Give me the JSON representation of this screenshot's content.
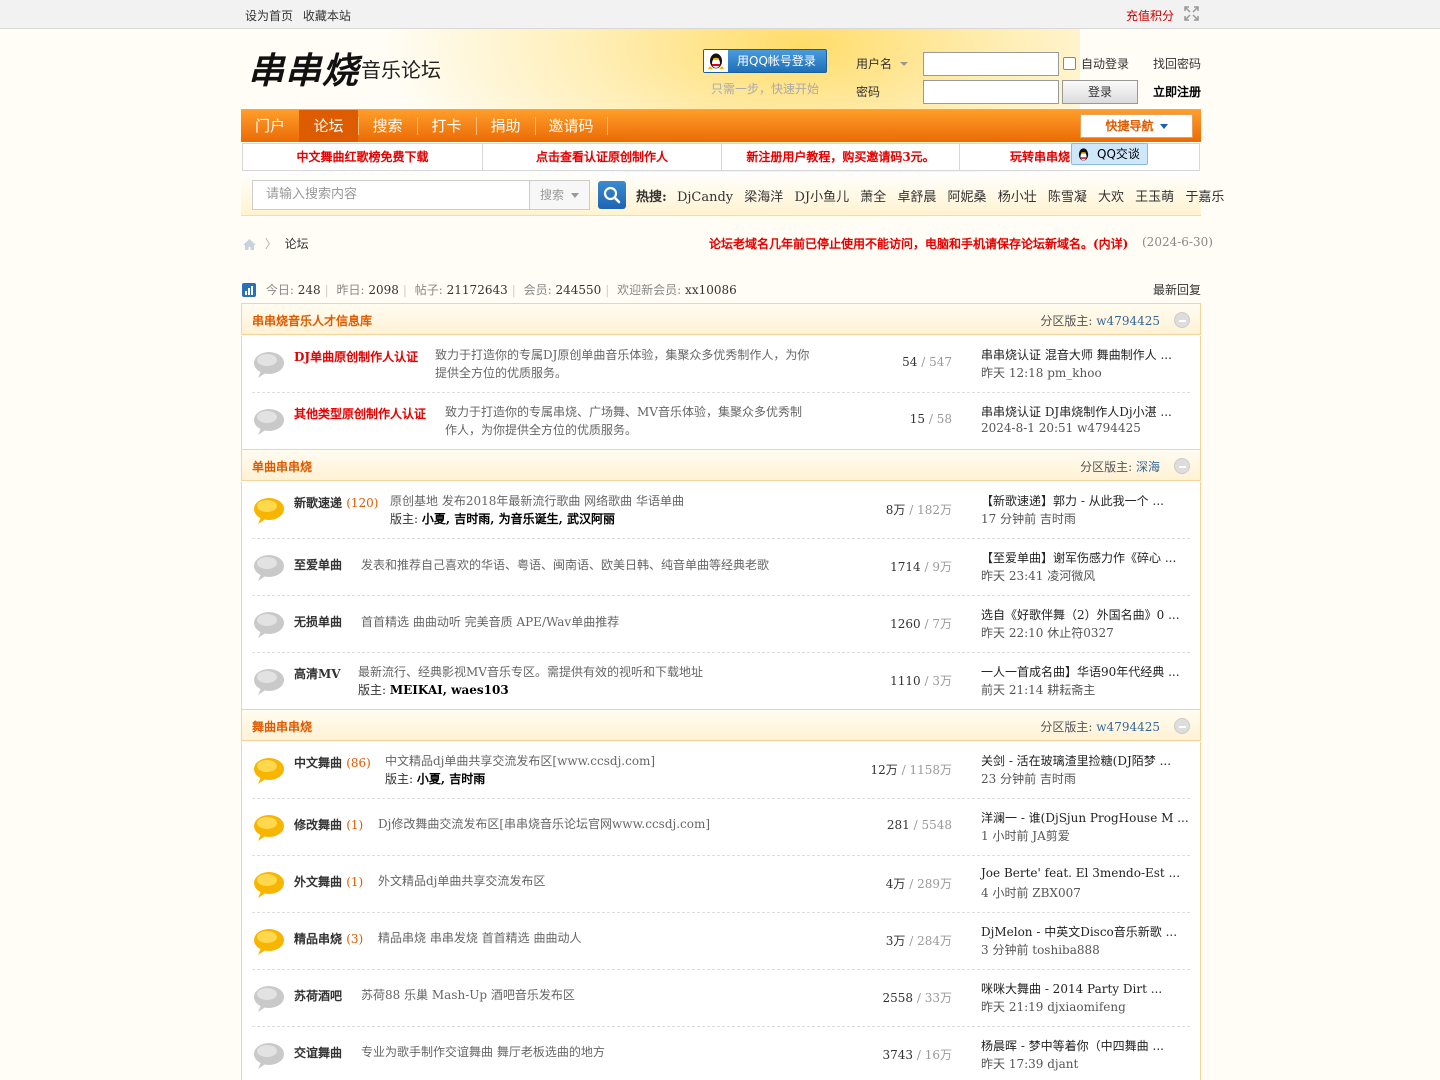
{
  "topbar": {
    "set_home": "设为首页",
    "favorite": "收藏本站",
    "recharge": "充值积分"
  },
  "logo": {
    "main": "串串烧",
    "sub": "音乐论坛"
  },
  "qq_login": {
    "button": "用QQ帐号登录",
    "hint": "只需一步，快速开始"
  },
  "login": {
    "username_label": "用户名",
    "password_label": "密码",
    "auto_login": "自动登录",
    "forgot": "找回密码",
    "login_button": "登录",
    "register": "立即注册"
  },
  "nav": {
    "items": [
      "门户",
      "论坛",
      "搜索",
      "打卡",
      "捐助",
      "邀请码"
    ],
    "active": "论坛",
    "quick_nav": "快捷导航"
  },
  "promo": [
    "中文舞曲红歌榜免费下载",
    "点击查看认证原创制作人",
    "新注册用户教程，购买邀请码3元。",
    "玩转串串烧"
  ],
  "qq_chat": "QQ交谈",
  "search": {
    "placeholder": "请输入搜索内容",
    "type": "搜索",
    "hot_label": "热搜:",
    "hot": [
      "DjCandy",
      "梁海洋",
      "DJ小鱼儿",
      "萧全",
      "卓舒晨",
      "阿妮桑",
      "杨小壮",
      "陈雪凝",
      "大欢",
      "王玉萌",
      "于嘉乐"
    ]
  },
  "breadcrumb": {
    "current": "论坛"
  },
  "notice": {
    "text": "论坛老域名几年前已停止使用不能访问，电脑和手机请保存论坛新域名。(内详)",
    "date": "(2024-6-30)"
  },
  "stats": {
    "today_label": "今日:",
    "today": "248",
    "yesterday_label": "昨日:",
    "yesterday": "2098",
    "posts_label": "帖子:",
    "posts": "21172643",
    "members_label": "会员:",
    "members": "244550",
    "newest_label": "欢迎新会员:",
    "newest": "xx10086",
    "latest_reply": "最新回复"
  },
  "sections": [
    {
      "title": "串串烧音乐人才信息库",
      "mod_label": "分区版主:",
      "mod": "w4794425",
      "forums": [
        {
          "name": "DJ单曲原创制作人认证",
          "count": "",
          "desc1": "致力于打造你的专属DJ原创单曲音乐体验，集聚众多优秀制作人，为你",
          "desc2": "提供全方位的优质服务。",
          "mods_label": "",
          "mods": "",
          "threads": "54",
          "posts": "547",
          "last_title": "串串烧认证 混音大师 舞曲制作人 ...",
          "last_meta": "昨天 12:18 pm_khoo"
        },
        {
          "name": "其他类型原创制作人认证",
          "count": "",
          "desc1": "致力于打造你的专属串烧、广场舞、MV音乐体验，集聚众多优秀制",
          "desc2": "作人，为你提供全方位的优质服务。",
          "mods_label": "",
          "mods": "",
          "threads": "15",
          "posts": "58",
          "last_title": "串串烧认证 DJ串烧制作人Dj小湛 ...",
          "last_meta": "2024-8-1 20:51 w4794425"
        }
      ]
    },
    {
      "title": "单曲串串烧",
      "mod_label": "分区版主:",
      "mod": "深海",
      "forums": [
        {
          "name": "新歌速递",
          "count": "(120)",
          "desc1": "原创基地 发布2018年最新流行歌曲 网络歌曲 华语单曲",
          "desc2": "",
          "mods_label": "版主:",
          "mods": "小夏, 吉时雨, 为音乐诞生, 武汉阿丽",
          "threads": "8万",
          "posts": "182万",
          "last_title": "【新歌速递】郭力 - 从此我一个 ...",
          "last_meta": "17 分钟前 吉时雨"
        },
        {
          "name": "至爱单曲",
          "count": "",
          "desc1": "发表和推荐自己喜欢的华语、粤语、闽南语、欧美日韩、纯音单曲等经典老歌",
          "desc2": "",
          "mods_label": "",
          "mods": "",
          "threads": "1714",
          "posts": "9万",
          "last_title": "【至爱单曲】谢军伤感力作《碎心 ...",
          "last_meta": "昨天 23:41 凌河微风"
        },
        {
          "name": "无损单曲",
          "count": "",
          "desc1": "首首精选 曲曲动听 完美音质 APE/Wav单曲推荐",
          "desc2": "",
          "mods_label": "",
          "mods": "",
          "threads": "1260",
          "posts": "7万",
          "last_title": "选自《好歌伴舞（2）外国名曲》0 ...",
          "last_meta": "昨天 22:10 休止符0327"
        },
        {
          "name": "高清MV",
          "count": "",
          "desc1": "最新流行、经典影视MV音乐专区。需提供有效的视听和下载地址",
          "desc2": "",
          "mods_label": "版主:",
          "mods": "MEIKAI, waes103",
          "threads": "1110",
          "posts": "3万",
          "last_title": "一人一首成名曲】华语90年代经典 ...",
          "last_meta": "前天 21:14 耕耘斋主"
        }
      ]
    },
    {
      "title": "舞曲串串烧",
      "mod_label": "分区版主:",
      "mod": "w4794425",
      "forums": [
        {
          "name": "中文舞曲",
          "count": "(86)",
          "desc1": "中文精品dj单曲共享交流发布区[www.ccsdj.com]",
          "desc2": "",
          "mods_label": "版主:",
          "mods": "小夏, 吉时雨",
          "threads": "12万",
          "posts": "1158万",
          "last_title": "关剑 - 活在玻璃渣里捡糖(DJ陌梦 ...",
          "last_meta": "23 分钟前 吉时雨"
        },
        {
          "name": "修改舞曲",
          "count": "(1)",
          "desc1": "Dj修改舞曲交流发布区[串串烧音乐论坛官网www.ccsdj.com]",
          "desc2": "",
          "mods_label": "",
          "mods": "",
          "threads": "281",
          "posts": "5548",
          "last_title": "洋澜一 - 谁(DjSjun ProgHouse M ...",
          "last_meta": "1 小时前 JA剪爱"
        },
        {
          "name": "外文舞曲",
          "count": "(1)",
          "desc1": "外文精品dj单曲共享交流发布区",
          "desc2": "",
          "mods_label": "",
          "mods": "",
          "threads": "4万",
          "posts": "289万",
          "last_title": "Joe Berte' feat. El 3mendo-Est ...",
          "last_meta": "4 小时前 ZBX007"
        },
        {
          "name": "精品串烧",
          "count": "(3)",
          "desc1": "精品串烧 串串发烧 首首精选 曲曲动人",
          "desc2": "",
          "mods_label": "",
          "mods": "",
          "threads": "3万",
          "posts": "284万",
          "last_title": "DjMelon - 中英文Disco音乐新歌 ...",
          "last_meta": "3 分钟前 toshiba888"
        },
        {
          "name": "苏荷酒吧",
          "count": "",
          "desc1": "苏荷88 乐巢 Mash-Up 酒吧音乐发布区",
          "desc2": "",
          "mods_label": "",
          "mods": "",
          "threads": "2558",
          "posts": "33万",
          "last_title": "咪咪大舞曲 - 2014 Party Dirt ...",
          "last_meta": "昨天 21:19 djxiaomifeng"
        },
        {
          "name": "交谊舞曲",
          "count": "",
          "desc1": "专业为歌手制作交谊舞曲 舞厅老板选曲的地方",
          "desc2": "",
          "mods_label": "",
          "mods": "",
          "threads": "3743",
          "posts": "16万",
          "last_title": "杨晨晖 - 梦中等着你（中四舞曲 ...",
          "last_meta": "昨天 17:39 djant"
        }
      ]
    }
  ],
  "colors": {
    "accent": "#ea6b05",
    "red": "#e60000",
    "section_title": "#e05b00",
    "link": "#336699"
  }
}
